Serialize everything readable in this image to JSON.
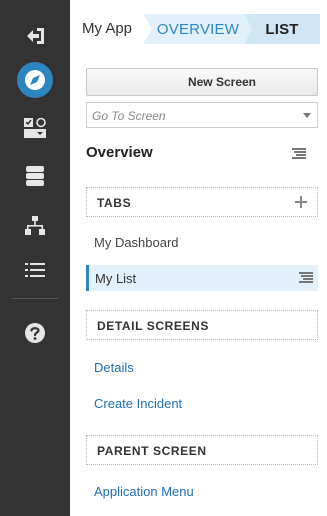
{
  "header": {
    "app_name": "My App",
    "breadcrumbs": [
      "OVERVIEW",
      "LIST"
    ]
  },
  "rail": {
    "icons": [
      "sign-out-icon",
      "compass-icon",
      "screen-toggle-icon",
      "database-icon",
      "sitemap-icon",
      "list-icon",
      "help-icon"
    ],
    "active_index": 1,
    "accent_color": "#2e86c1"
  },
  "toolbar": {
    "new_screen_label": "New Screen",
    "goto_placeholder": "Go To Screen"
  },
  "overview": {
    "title": "Overview"
  },
  "tabs_section": {
    "label": "TABS",
    "items": [
      {
        "label": "My Dashboard",
        "selected": false
      },
      {
        "label": "My List",
        "selected": true
      }
    ]
  },
  "detail_section": {
    "label": "DETAIL SCREENS",
    "items": [
      "Details",
      "Create Incident"
    ]
  },
  "parent_section": {
    "label": "PARENT SCREEN",
    "items": [
      "Application Menu"
    ]
  }
}
